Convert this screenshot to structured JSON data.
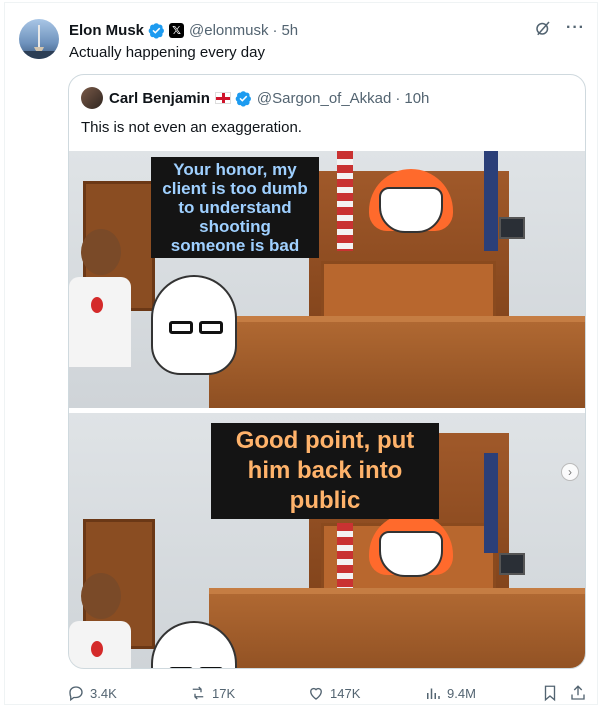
{
  "tweet": {
    "author_name": "Elon Musk",
    "handle": "@elonmusk",
    "separator": "·",
    "time": "5h",
    "text": "Actually happening every day",
    "more_label": "···"
  },
  "quoted": {
    "author_name": "Carl Benjamin",
    "handle": "@Sargon_of_Akkad",
    "separator": "·",
    "time": "10h",
    "text": "This is not even an exaggeration.",
    "meme": {
      "caption_top": [
        "Your honor, my",
        "client is too dumb",
        "to understand",
        "shooting",
        "someone is bad"
      ],
      "caption_bottom": [
        "Good point, put",
        "him back into",
        "public"
      ]
    }
  },
  "metrics": {
    "replies": "3.4K",
    "reposts": "17K",
    "likes": "147K",
    "views": "9.4M"
  },
  "colors": {
    "verified_blue": "#1d9bf0",
    "secondary_text": "#536471",
    "border": "#cfd9de"
  }
}
